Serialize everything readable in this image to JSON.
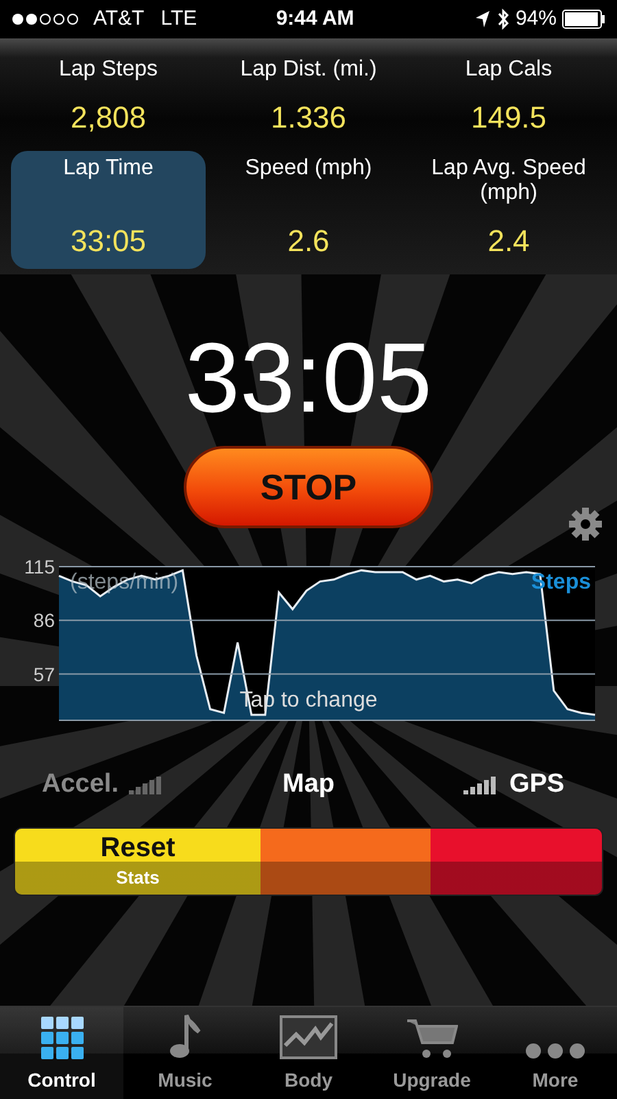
{
  "status_bar": {
    "carrier": "AT&T",
    "network": "LTE",
    "time": "9:44 AM",
    "battery": "94%"
  },
  "stats": [
    {
      "label": "Lap Steps",
      "value": "2,808",
      "selected": false
    },
    {
      "label": "Lap Dist. (mi.)",
      "value": "1.336",
      "selected": false
    },
    {
      "label": "Lap Cals",
      "value": "149.5",
      "selected": false
    },
    {
      "label": "Lap Time",
      "value": "33:05",
      "selected": true
    },
    {
      "label": "Speed (mph)",
      "value": "2.6",
      "selected": false
    },
    {
      "label": "Lap Avg. Speed (mph)",
      "value": "2.4",
      "selected": false
    }
  ],
  "timer": "33:05",
  "stop_button": "STOP",
  "chart": {
    "hint": "Tap to change",
    "chart_data": {
      "type": "area",
      "ylabel": "(steps/min)",
      "ylim": [
        32,
        115
      ],
      "yticks": [
        115,
        86,
        57
      ],
      "series": [
        {
          "name": "Steps",
          "color": "#1a8fd8",
          "values": [
            110,
            107,
            105,
            99,
            104,
            108,
            110,
            108,
            110,
            113,
            67,
            38,
            36,
            74,
            35,
            35,
            101,
            92,
            102,
            107,
            108,
            111,
            113,
            112,
            112,
            112,
            108,
            110,
            107,
            108,
            106,
            110,
            112,
            111,
            112,
            111,
            48,
            38,
            36,
            35
          ]
        }
      ]
    }
  },
  "sensors": [
    {
      "label": "Accel.",
      "kind": "bars_after",
      "enabled": false
    },
    {
      "label": "Map",
      "kind": "plain",
      "enabled": true
    },
    {
      "label": "GPS",
      "kind": "bars_before",
      "enabled": true
    }
  ],
  "reset_bar": [
    {
      "label": "Reset",
      "sublabel": "Stats",
      "color": "#f7dc1c"
    },
    {
      "color": "#f56a1c"
    },
    {
      "color": "#e8102c"
    }
  ],
  "tabs": [
    {
      "label": "Control",
      "kind": "grid",
      "selected": true
    },
    {
      "label": "Music",
      "kind": "note",
      "selected": false
    },
    {
      "label": "Body",
      "kind": "chart",
      "selected": false
    },
    {
      "label": "Upgrade",
      "kind": "cart",
      "selected": false
    },
    {
      "label": "More",
      "kind": "dots",
      "selected": false
    }
  ]
}
